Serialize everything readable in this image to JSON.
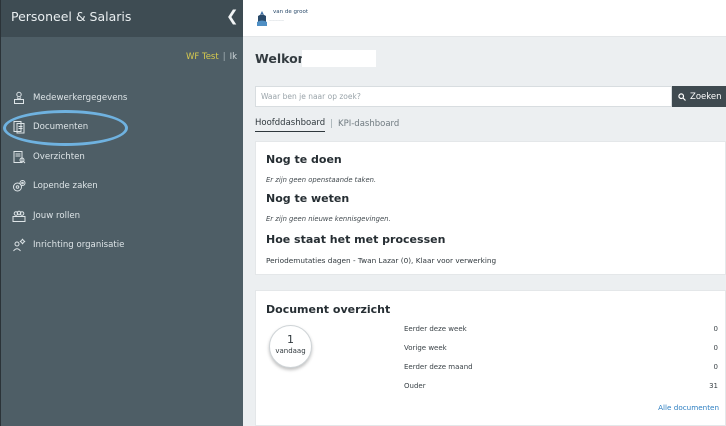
{
  "sidebar": {
    "title": "Personeel & Salaris",
    "collapse_icon": "chevron-left-icon",
    "user": {
      "name": "WF Test",
      "separator": "|",
      "me": "Ik"
    },
    "items": [
      {
        "label": "Medewerkergegevens",
        "icon": "employee-icon"
      },
      {
        "label": "Documenten",
        "icon": "documents-icon"
      },
      {
        "label": "Overzichten",
        "icon": "overview-icon"
      },
      {
        "label": "Lopende zaken",
        "icon": "running-cases-icon"
      },
      {
        "label": "Jouw rollen",
        "icon": "roles-icon"
      },
      {
        "label": "Inrichting organisatie",
        "icon": "organisation-settings-icon"
      }
    ],
    "highlight_color": "#6fb2e0"
  },
  "header": {
    "logo_text": "van de groot",
    "logo_icon": "company-logo-icon"
  },
  "main": {
    "welcome": "Welkom",
    "search": {
      "placeholder": "Waar ben je naar op zoek?",
      "button_label": "Zoeken",
      "button_icon": "search-icon"
    },
    "tabs": [
      {
        "label": "Hoofddashboard",
        "active": true
      },
      {
        "label": "KPI-dashboard",
        "active": false
      }
    ],
    "tab_separator": "|",
    "todo": {
      "title": "Nog te doen",
      "note": "Er zijn geen openstaande taken.",
      "know_title": "Nog te weten",
      "know_note": "Er zijn geen nieuwe kennisgevingen.",
      "process_title": "Hoe staat het met processen",
      "process_line": "Periodemutaties dagen - Twan Lazar (0), Klaar voor verwerking"
    },
    "documents": {
      "title": "Document overzicht",
      "today_count": "1",
      "today_label": "vandaag",
      "rows": [
        {
          "label": "Eerder deze week",
          "value": "0"
        },
        {
          "label": "Vorige week",
          "value": "0"
        },
        {
          "label": "Eerder deze maand",
          "value": "0"
        },
        {
          "label": "Ouder",
          "value": "31"
        }
      ],
      "link": "Alle documenten"
    }
  },
  "colors": {
    "sidebar_bg": "#4e5e66",
    "sidebar_header_bg": "#3e4c53",
    "accent_user": "#d6c94e",
    "link": "#2e7fc2",
    "button_bg": "#3f4a50"
  }
}
